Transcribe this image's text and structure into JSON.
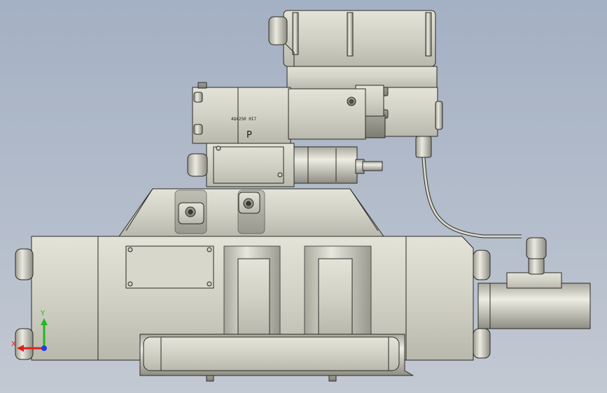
{
  "viewport": {
    "background_top": "#a4b0c3",
    "background_bottom": "#c3c9d3",
    "part_color": "#d2d1c5",
    "edge_color": "#2b2b28"
  },
  "part": {
    "marking_text": "4Q4250 0I7",
    "port_label": "P"
  },
  "triad": {
    "x_label": "X",
    "y_label": "Y",
    "x_color": "#e02020",
    "y_color": "#22b822",
    "z_color": "#2040e0"
  }
}
